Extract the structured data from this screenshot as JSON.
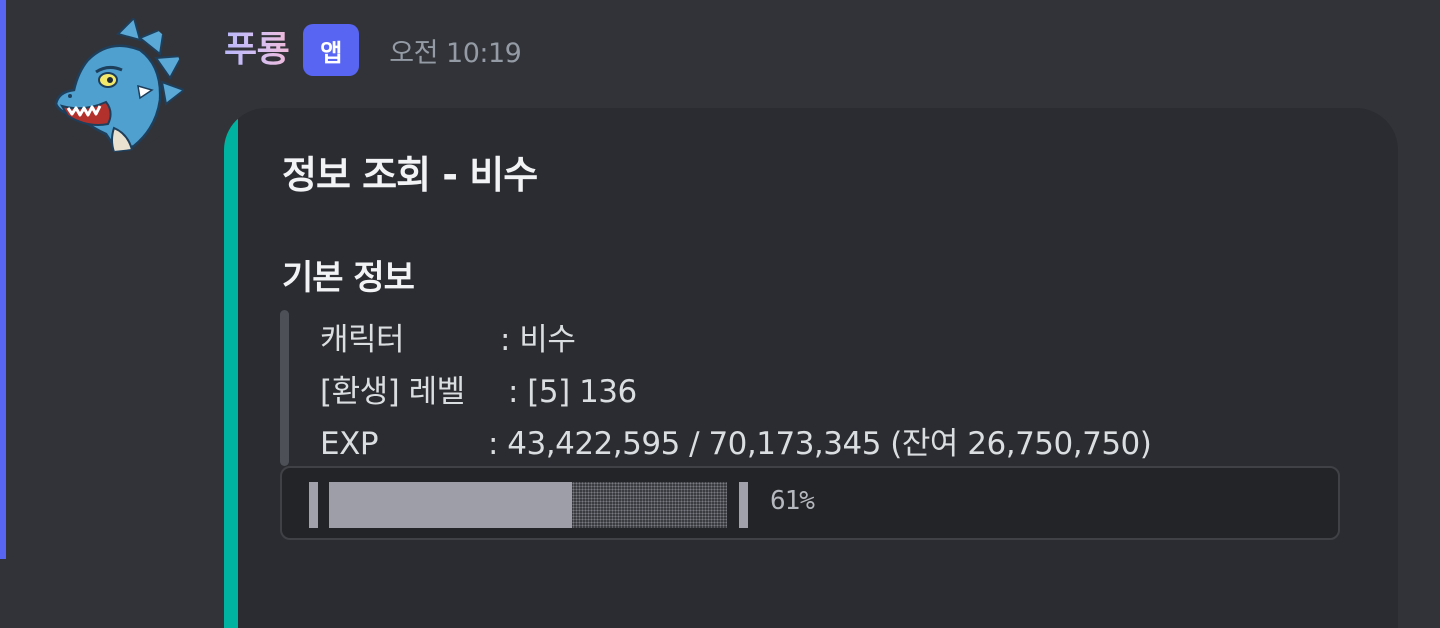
{
  "message": {
    "username": "푸룡",
    "badge": "앱",
    "timestamp": "오전 10:19",
    "avatar_icon": "blue-dragon-avatar-icon"
  },
  "embed": {
    "accent_color": "#00b3a0",
    "title": "정보 조회 - 비수",
    "field_name": "기본 정보",
    "rows": [
      {
        "label": "캐릭터",
        "value": ": 비수"
      },
      {
        "label": "[환생] 레벨",
        "value": ": [5] 136"
      },
      {
        "label": "EXP",
        "value": ": 43,422,595 / 70,173,345 (잔여 26,750,750)"
      }
    ],
    "progress": {
      "percent_label": "61%",
      "fraction": 0.61
    }
  },
  "colors": {
    "mention_bar": "#5865f2",
    "badge_bg": "#5865f2",
    "background": "#323339",
    "embed_bg": "#2b2c31"
  }
}
